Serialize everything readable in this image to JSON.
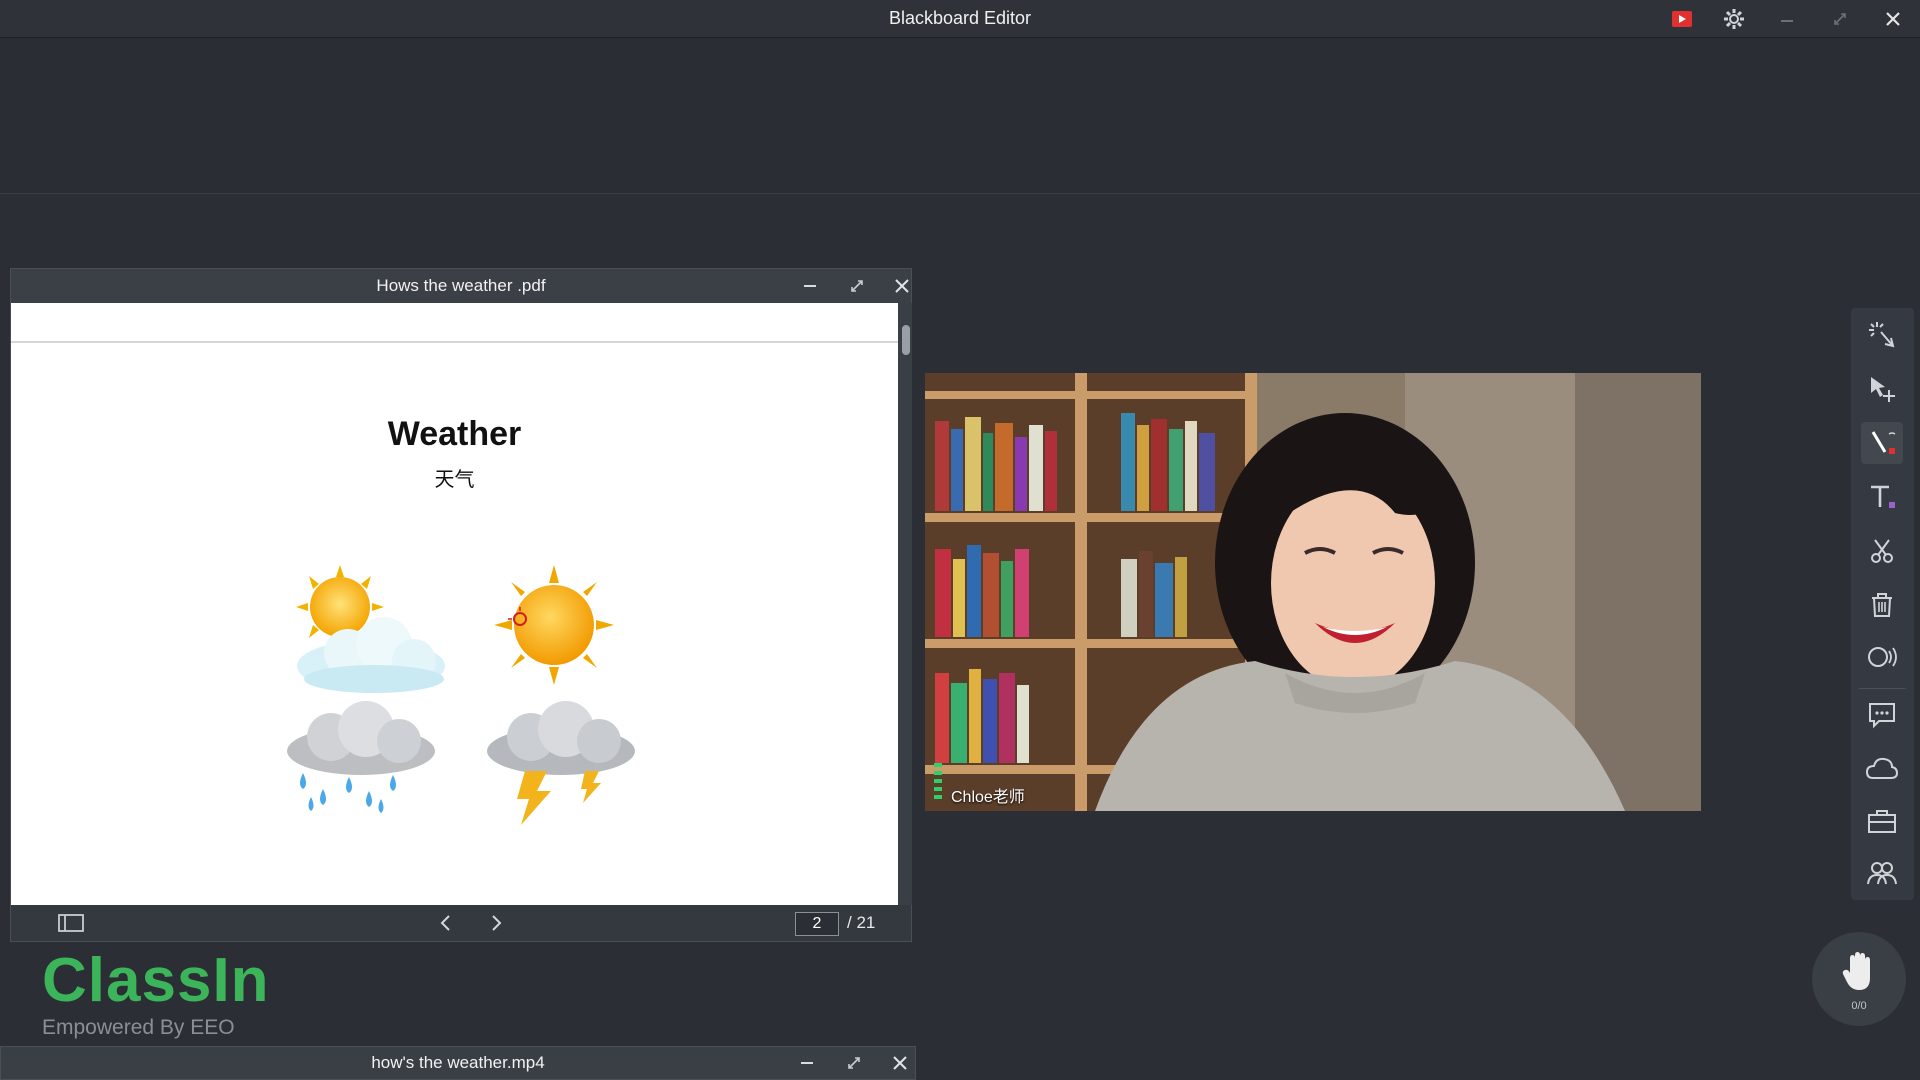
{
  "app": {
    "title": "Blackboard Editor",
    "record_color": "#e03030"
  },
  "pdf_window": {
    "title": "Hows the weather .pdf",
    "slide": {
      "title": "Weather",
      "subtitle": "天气"
    },
    "current_page": "2",
    "total_pages": "/ 21"
  },
  "video": {
    "participant_label": "Chloe老师"
  },
  "toolbar": {
    "tools": [
      "laser-pointer-icon",
      "select-move-icon",
      "pen-icon",
      "text-icon",
      "scissors-icon",
      "trash-icon",
      "audio-icon",
      "chat-icon",
      "cloud-icon",
      "toolbox-icon",
      "students-icon"
    ]
  },
  "hand_raise": {
    "count": "0/0"
  },
  "logo": {
    "word": "ClassIn",
    "tagline": "Empowered By EEO",
    "color": "#3cb55a"
  },
  "media_window": {
    "title": "how's the weather.mp4"
  }
}
